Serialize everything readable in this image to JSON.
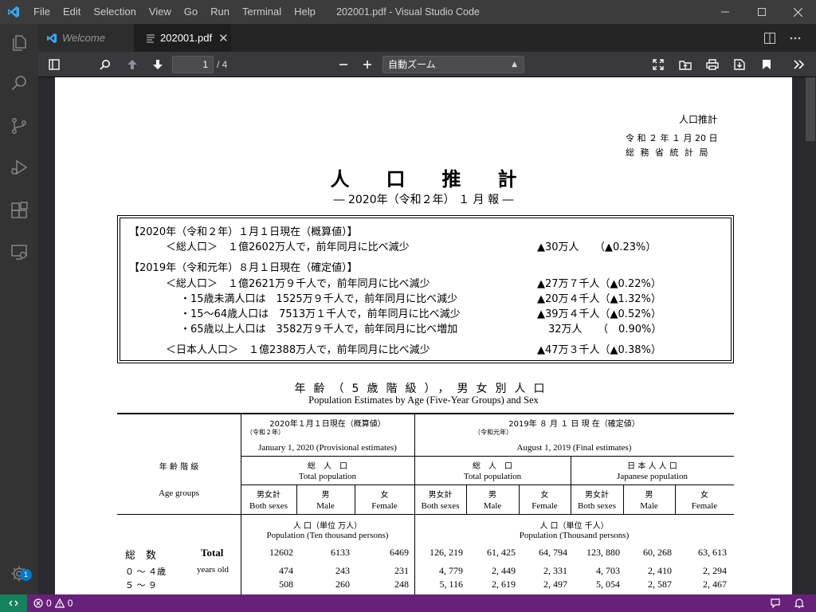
{
  "window": {
    "title": "202001.pdf - Visual Studio Code",
    "menu": [
      "File",
      "Edit",
      "Selection",
      "View",
      "Go",
      "Run",
      "Terminal",
      "Help"
    ]
  },
  "activity_bar": {
    "icons": [
      "files-icon",
      "search-icon",
      "source-control-icon",
      "run-debug-icon",
      "extensions-icon",
      "remote-explorer-icon"
    ],
    "settings_badge": "1"
  },
  "tabs": [
    {
      "label": "Welcome",
      "active": false
    },
    {
      "label": "202001.pdf",
      "active": true
    }
  ],
  "pdf_toolbar": {
    "page_number": "1",
    "page_count": "/ 4",
    "zoom_value": "自動ズーム"
  },
  "document": {
    "header_label": "人口推計",
    "date_line": "令 和 ２ 年 １ 月 20 日",
    "agency_line": "総 務 省 統 計 局",
    "title": "人口推計",
    "subtitle": "― 2020年（令和２年） １ 月 報 ―",
    "summary": {
      "line1": "【2020年（令和２年）１月１日現在（概算値）】",
      "line2_label": "＜総人口＞　１億2602万人で，前年同月に比べ減少",
      "line2_value": "▲30万人　　（▲0.23%）",
      "line3": "【2019年（令和元年）８月１日現在（確定値）】",
      "line4_label": "＜総人口＞　１億2621万９千人で，前年同月に比べ減少",
      "line4_value": "▲27万７千人（▲0.22%）",
      "line5_label": "・15歳未満人口は　1525万９千人で，前年同月に比べ減少",
      "line5_value": "▲20万４千人（▲1.32%）",
      "line6_label": "・15～64歳人口は　7513万１千人で，前年同月に比べ減少",
      "line6_value": "▲39万４千人（▲0.52%）",
      "line7_label": "・65歳以上人口は　3582万９千人で，前年同月に比べ増加",
      "line7_value": "32万人　　（　0.90%）",
      "line8_label": "＜日本人人口＞　１億2388万人で，前年同月に比べ減少",
      "line8_value": "▲47万３千人（▲0.38%）"
    },
    "table_title": "年齢（5歳階級），男女別人口",
    "table_title_en": "Population Estimates by Age (Five-Year Groups) and Sex",
    "table": {
      "age_groups_jp": "年 齢 階 級",
      "age_groups_en": "Age groups",
      "col_2020_jp": "2020年１月１日現在（概算値）",
      "col_2020_era": "（令和２年）",
      "col_2020_en": "January 1, 2020 (Provisional estimates)",
      "col_2019_jp": "2019年 ８ 月 １ 日 現 在（確定値）",
      "col_2019_era": "（令和元年）",
      "col_2019_en": "August 1, 2019 (Final estimates)",
      "total_pop_jp": "総　人　口",
      "total_pop_en": "Total population",
      "japanese_pop_jp": "日 本 人 人 口",
      "japanese_pop_en": "Japanese population",
      "sex_headers": [
        {
          "jp": "男女計",
          "en": "Both sexes"
        },
        {
          "jp": "男",
          "en": "Male"
        },
        {
          "jp": "女",
          "en": "Female"
        }
      ],
      "unit_left_jp": "人 口（単位 万人）",
      "unit_left_en": "Population (Ten thousand persons)",
      "unit_right_jp": "人 口（単位 千人）",
      "unit_right_en": "Population (Thousand persons)",
      "rows": [
        {
          "label_jp": "総　数",
          "label_en": "Total",
          "values": [
            "12602",
            "6133",
            "6469",
            "126, 219",
            "61, 425",
            "64, 794",
            "123, 880",
            "60, 268",
            "63, 613"
          ]
        },
        {
          "label_jp": "０ ～ ４歳",
          "label_en": "years old",
          "values": [
            "474",
            "243",
            "231",
            "4, 779",
            "2, 449",
            "2, 331",
            "4, 703",
            "2, 410",
            "2, 294"
          ]
        },
        {
          "label_jp": "５ ～ ９",
          "label_en": "",
          "values": [
            "508",
            "260",
            "248",
            "5, 116",
            "2, 619",
            "2, 497",
            "5, 054",
            "2, 587",
            "2, 467"
          ]
        }
      ]
    }
  },
  "status_bar": {
    "errors": "0",
    "warnings": "0"
  }
}
